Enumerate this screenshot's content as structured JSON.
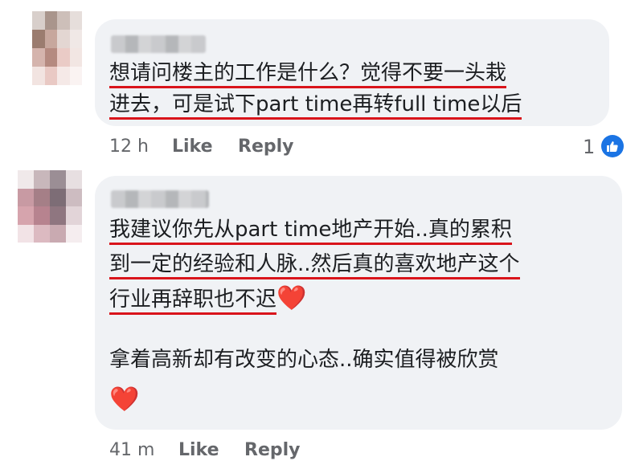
{
  "comments": [
    {
      "lines": [
        "想请问楼主的工作是什么？觉得不要一头栽",
        "进去，可是试下part time再转full time以后"
      ],
      "time": "12 h",
      "like_label": "Like",
      "reply_label": "Reply",
      "reaction_count": "1",
      "reaction_icon": "thumbs-up-icon"
    },
    {
      "lines": [
        "我建议你先从part time地产开始..真的累积",
        "到一定的经验和人脉..然后真的喜欢地产这个",
        "行业再辞职也不迟"
      ],
      "heart_emoji": "❤️",
      "paragraph2": "拿着高新却有改变的心态..确实值得被欣赏",
      "time": "41 m",
      "like_label": "Like",
      "reply_label": "Reply"
    }
  ],
  "colors": {
    "bubble": "#f0f2f5",
    "underline": "#d9141b",
    "meta_text": "#65676b",
    "like_badge": "#1b74e4"
  }
}
